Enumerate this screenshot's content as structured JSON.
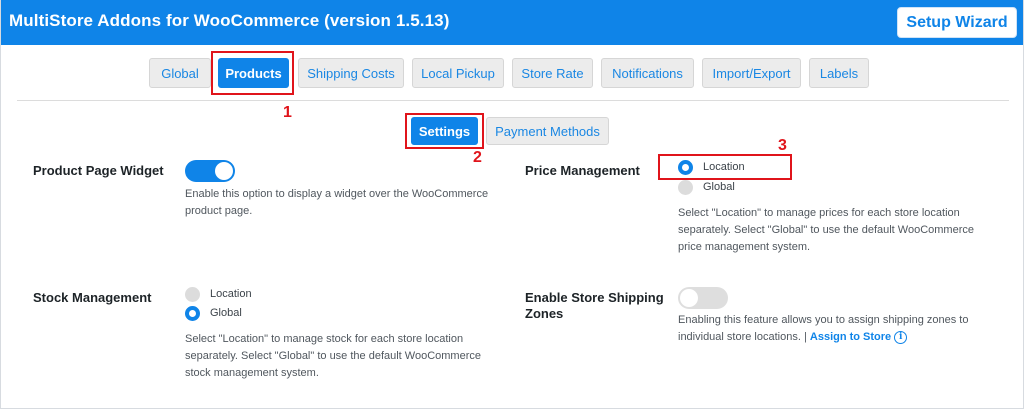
{
  "header": {
    "title": "MultiStore Addons for WooCommerce (version 1.5.13)",
    "setup_label": "Setup Wizard"
  },
  "tabs": [
    {
      "label": "Global",
      "active": false
    },
    {
      "label": "Products",
      "active": true
    },
    {
      "label": "Shipping Costs",
      "active": false
    },
    {
      "label": "Local Pickup",
      "active": false
    },
    {
      "label": "Store Rate",
      "active": false
    },
    {
      "label": "Notifications",
      "active": false
    },
    {
      "label": "Import/Export",
      "active": false
    },
    {
      "label": "Labels",
      "active": false
    }
  ],
  "subtabs": [
    {
      "label": "Settings",
      "active": true
    },
    {
      "label": "Payment Methods",
      "active": false
    }
  ],
  "markers": [
    "1",
    "2",
    "3"
  ],
  "settings": {
    "product_page_widget": {
      "label": "Product Page Widget",
      "enabled": true,
      "desc_line1": "Enable this option to display a widget over the WooCommerce",
      "desc_line2": "product page."
    },
    "price_management": {
      "label": "Price Management",
      "options": [
        "Location",
        "Global"
      ],
      "selected": "Location",
      "desc_line1": "Select \"Location\" to manage prices for each store location",
      "desc_line2": "separately. Select \"Global\" to use the default WooCommerce",
      "desc_line3": "price management system."
    },
    "stock_management": {
      "label": "Stock Management",
      "options": [
        "Location",
        "Global"
      ],
      "selected": "Global",
      "desc_line1": "Select \"Location\" to manage stock for each store location",
      "desc_line2": "separately. Select \"Global\" to use the default WooCommerce",
      "desc_line3": "stock management system."
    },
    "store_shipping_zones": {
      "label_line1": "Enable Store Shipping",
      "label_line2": "Zones",
      "enabled": false,
      "desc_line1": "Enabling this feature allows you to assign shipping zones to",
      "desc_line2_prefix": "individual store locations. |",
      "link_label": "Assign to Store",
      "info_glyph": "i"
    }
  },
  "colors": {
    "accent": "#0f84e8",
    "highlight": "#e0141b"
  }
}
